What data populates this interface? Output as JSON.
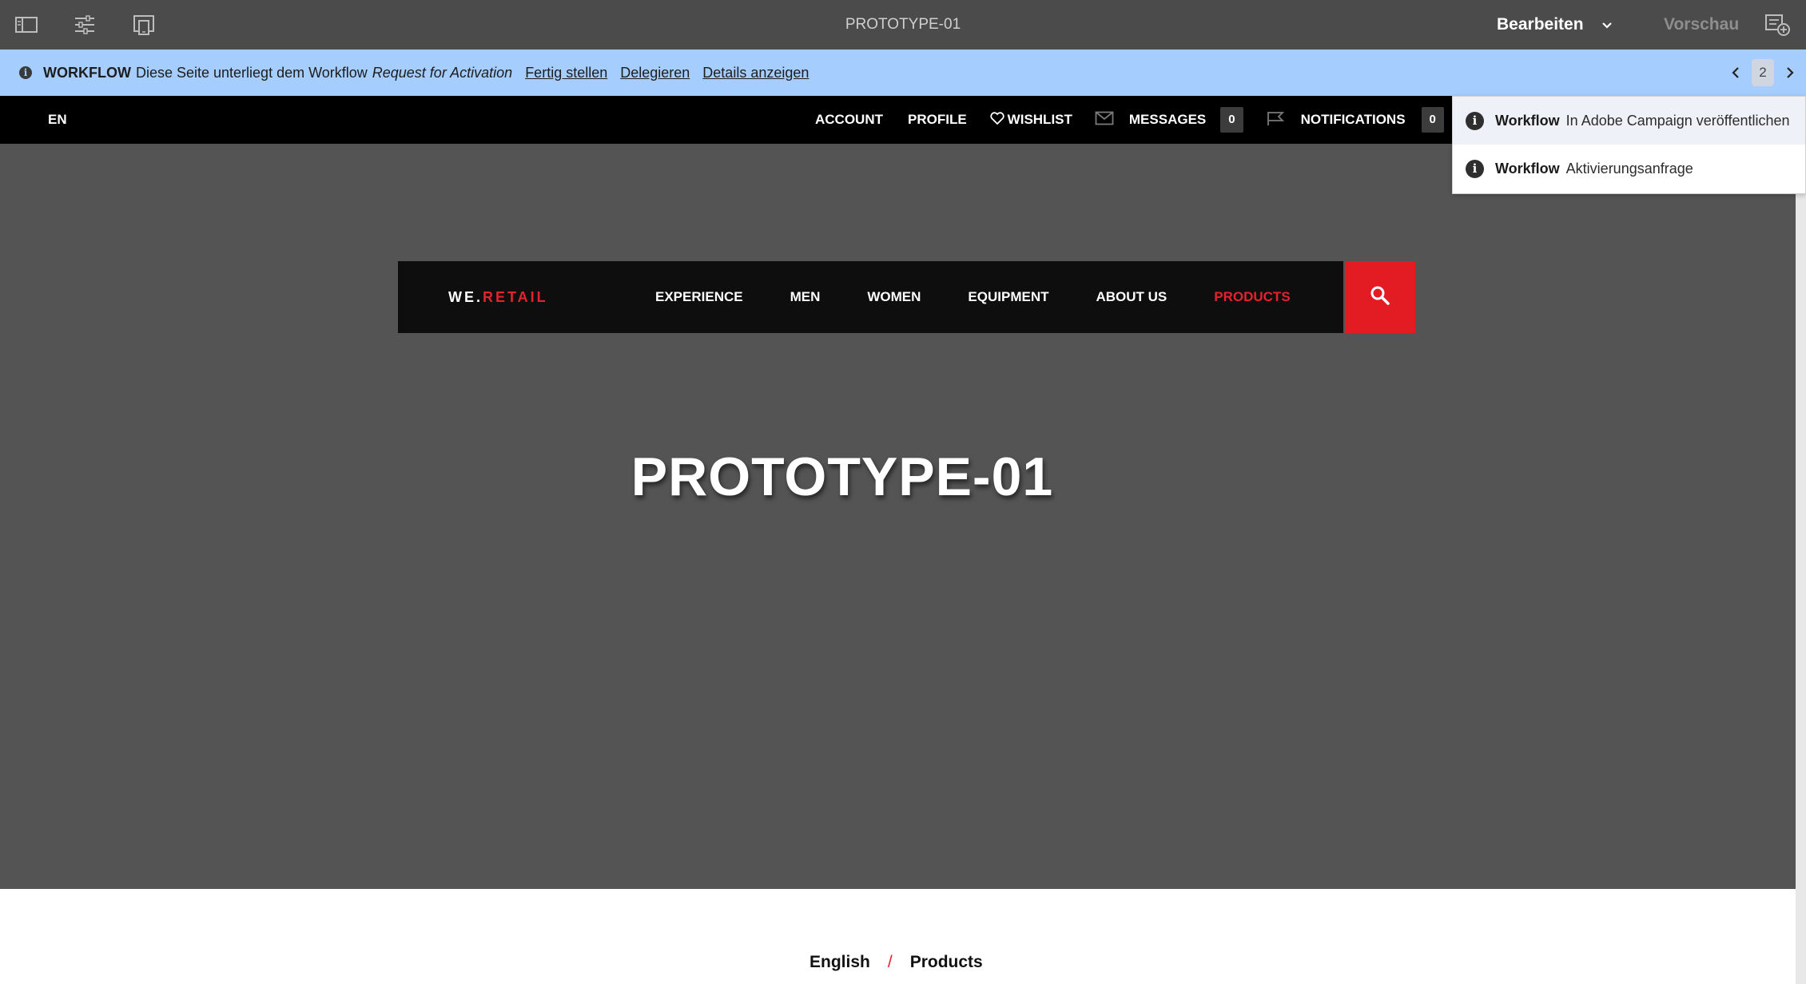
{
  "toolbar": {
    "page_title": "PROTOTYPE-01",
    "mode_label": "Bearbeiten",
    "preview_label": "Vorschau",
    "icons": [
      "side-panel-icon",
      "page-properties-icon",
      "emulator-icon",
      "chevron-down-icon",
      "annotation-icon"
    ]
  },
  "workflow_bar": {
    "label": "WORKFLOW",
    "text": "Diese Seite unterliegt dem Workflow",
    "workflow_name": "Request for Activation",
    "links": [
      "Fertig stellen",
      "Delegieren",
      "Details anzeigen"
    ],
    "page_number": "2",
    "background": "#a5cdfd"
  },
  "site_header": {
    "language": "EN",
    "nav": {
      "account": "ACCOUNT",
      "profile": "PROFILE",
      "wishlist": "WISHLIST",
      "messages": "MESSAGES",
      "messages_count": "0",
      "notifications": "NOTIFICATIONS",
      "notifications_count": "0"
    }
  },
  "main_nav": {
    "logo_prefix": "WE.",
    "logo_accent": "RETAIL",
    "items": [
      "EXPERIENCE",
      "MEN",
      "WOMEN",
      "EQUIPMENT",
      "ABOUT US",
      "PRODUCTS"
    ],
    "active_item": "PRODUCTS",
    "accent_color": "#e31b23"
  },
  "hero": {
    "title": "PROTOTYPE-01",
    "background": "#545454"
  },
  "breadcrumb": {
    "items": [
      "English",
      "Products"
    ],
    "separator": "/"
  },
  "workflow_popover": {
    "items": [
      {
        "label": "Workflow",
        "text": "In Adobe Campaign veröffentlichen"
      },
      {
        "label": "Workflow",
        "text": "Aktivierungsanfrage"
      }
    ]
  }
}
